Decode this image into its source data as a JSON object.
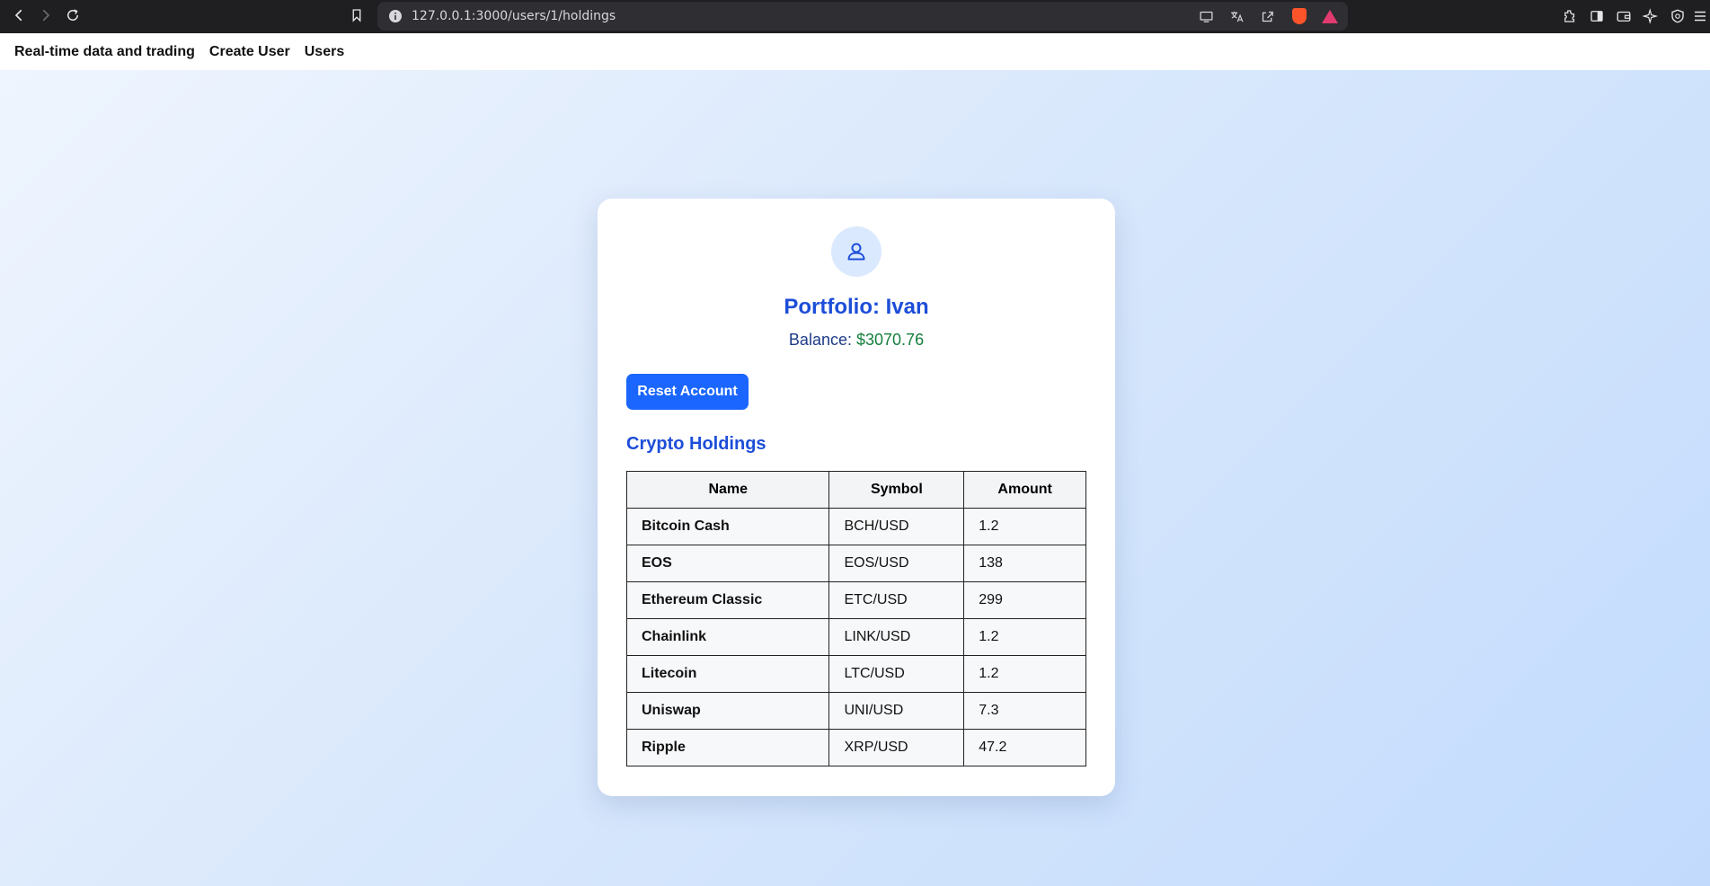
{
  "browser": {
    "url": "127.0.0.1:3000/users/1/holdings"
  },
  "nav": {
    "brand": "Real-time data and trading",
    "create_user": "Create User",
    "users": "Users"
  },
  "portfolio": {
    "title": "Portfolio: Ivan",
    "balance_label": "Balance:",
    "balance_value": "$3070.76",
    "reset_button": "Reset Account",
    "holdings_title": "Crypto Holdings"
  },
  "table": {
    "headers": [
      "Name",
      "Symbol",
      "Amount"
    ],
    "rows": [
      {
        "name": "Bitcoin Cash",
        "symbol": "BCH/USD",
        "amount": "1.2"
      },
      {
        "name": "EOS",
        "symbol": "EOS/USD",
        "amount": "138"
      },
      {
        "name": "Ethereum Classic",
        "symbol": "ETC/USD",
        "amount": "299"
      },
      {
        "name": "Chainlink",
        "symbol": "LINK/USD",
        "amount": "1.2"
      },
      {
        "name": "Litecoin",
        "symbol": "LTC/USD",
        "amount": "1.2"
      },
      {
        "name": "Uniswap",
        "symbol": "UNI/USD",
        "amount": "7.3"
      },
      {
        "name": "Ripple",
        "symbol": "XRP/USD",
        "amount": "47.2"
      }
    ]
  },
  "colors": {
    "accent": "#1d4ed8",
    "button": "#1a66ff",
    "balance": "#15803d"
  },
  "icons": {
    "avatar": "user-icon"
  }
}
